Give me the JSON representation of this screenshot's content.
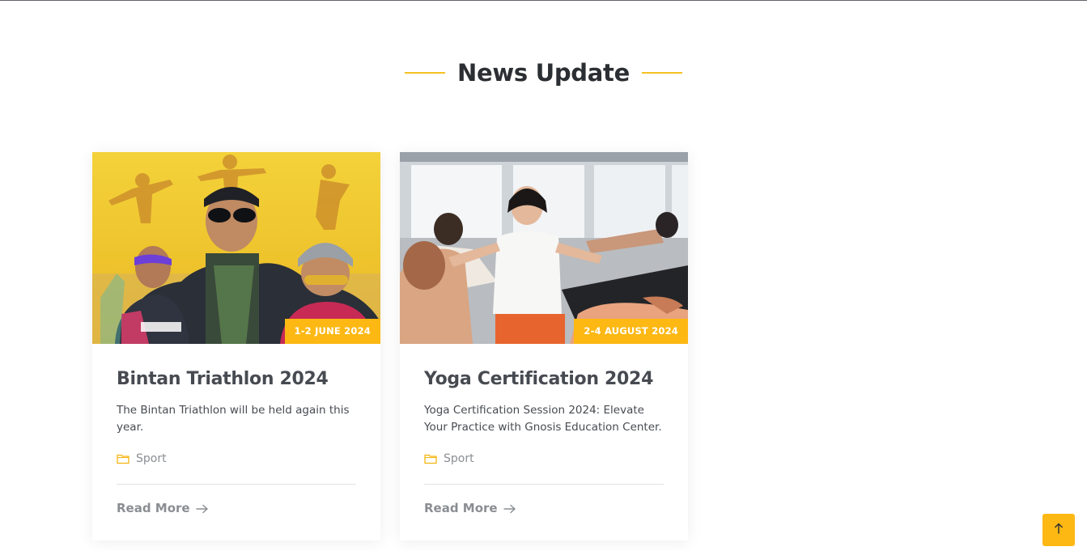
{
  "section": {
    "title": "News Update"
  },
  "colors": {
    "accent": "#fdb813",
    "heading": "#2b2f33",
    "muted": "#8a8e93"
  },
  "cards": [
    {
      "date": "1-2 JUNE 2024",
      "title": "Bintan Triathlon 2024",
      "excerpt": "The Bintan Triathlon will be held again this year.",
      "category": "Sport",
      "category_icon": "folder-icon",
      "read_more": "Read More",
      "read_more_icon": "arrow-right-icon"
    },
    {
      "date": "2-4 AUGUST 2024",
      "title": "Yoga Certification 2024",
      "excerpt": "Yoga Certification Session 2024: Elevate Your Practice with Gnosis Education Center.",
      "category": "Sport",
      "category_icon": "folder-icon",
      "read_more": "Read More",
      "read_more_icon": "arrow-right-icon"
    }
  ],
  "back_to_top": {
    "icon": "arrow-up-icon"
  }
}
